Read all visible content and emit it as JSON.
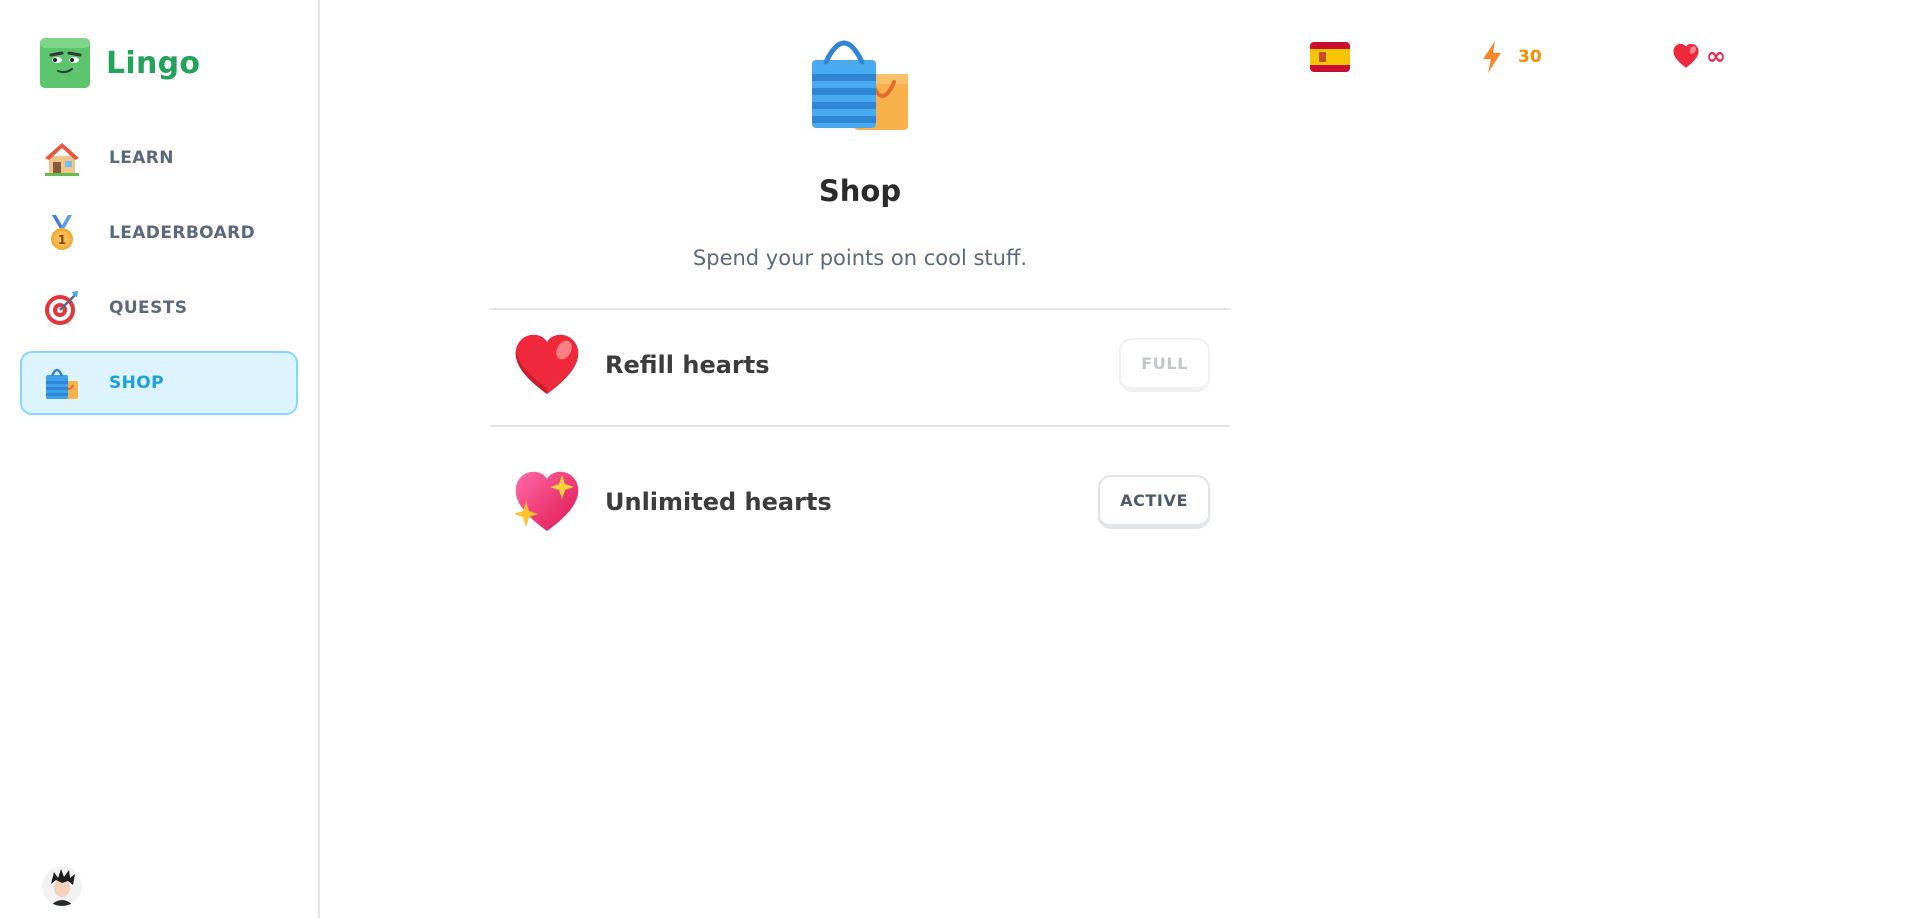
{
  "app": {
    "name": "Lingo"
  },
  "sidebar": {
    "items": [
      {
        "label": "LEARN",
        "icon": "house-icon",
        "active": false
      },
      {
        "label": "LEADERBOARD",
        "icon": "medal-icon",
        "active": false
      },
      {
        "label": "QUESTS",
        "icon": "target-icon",
        "active": false
      },
      {
        "label": "SHOP",
        "icon": "shopping-bags-icon",
        "active": true
      }
    ]
  },
  "header": {
    "course_flag": "spain-flag-icon",
    "points": "30",
    "hearts": "∞"
  },
  "shop": {
    "title": "Shop",
    "subtitle": "Spend your points on cool stuff.",
    "items": [
      {
        "label": "Refill hearts",
        "icon": "heart-icon",
        "button": "FULL"
      },
      {
        "label": "Unlimited hearts",
        "icon": "sparkling-heart-icon",
        "button": "ACTIVE"
      }
    ]
  },
  "colors": {
    "brand": "#22a35a",
    "active_nav_bg": "#ddf4ff",
    "active_nav_border": "#84d8ff",
    "points": "#f49000",
    "hearts": "#ee2450"
  }
}
